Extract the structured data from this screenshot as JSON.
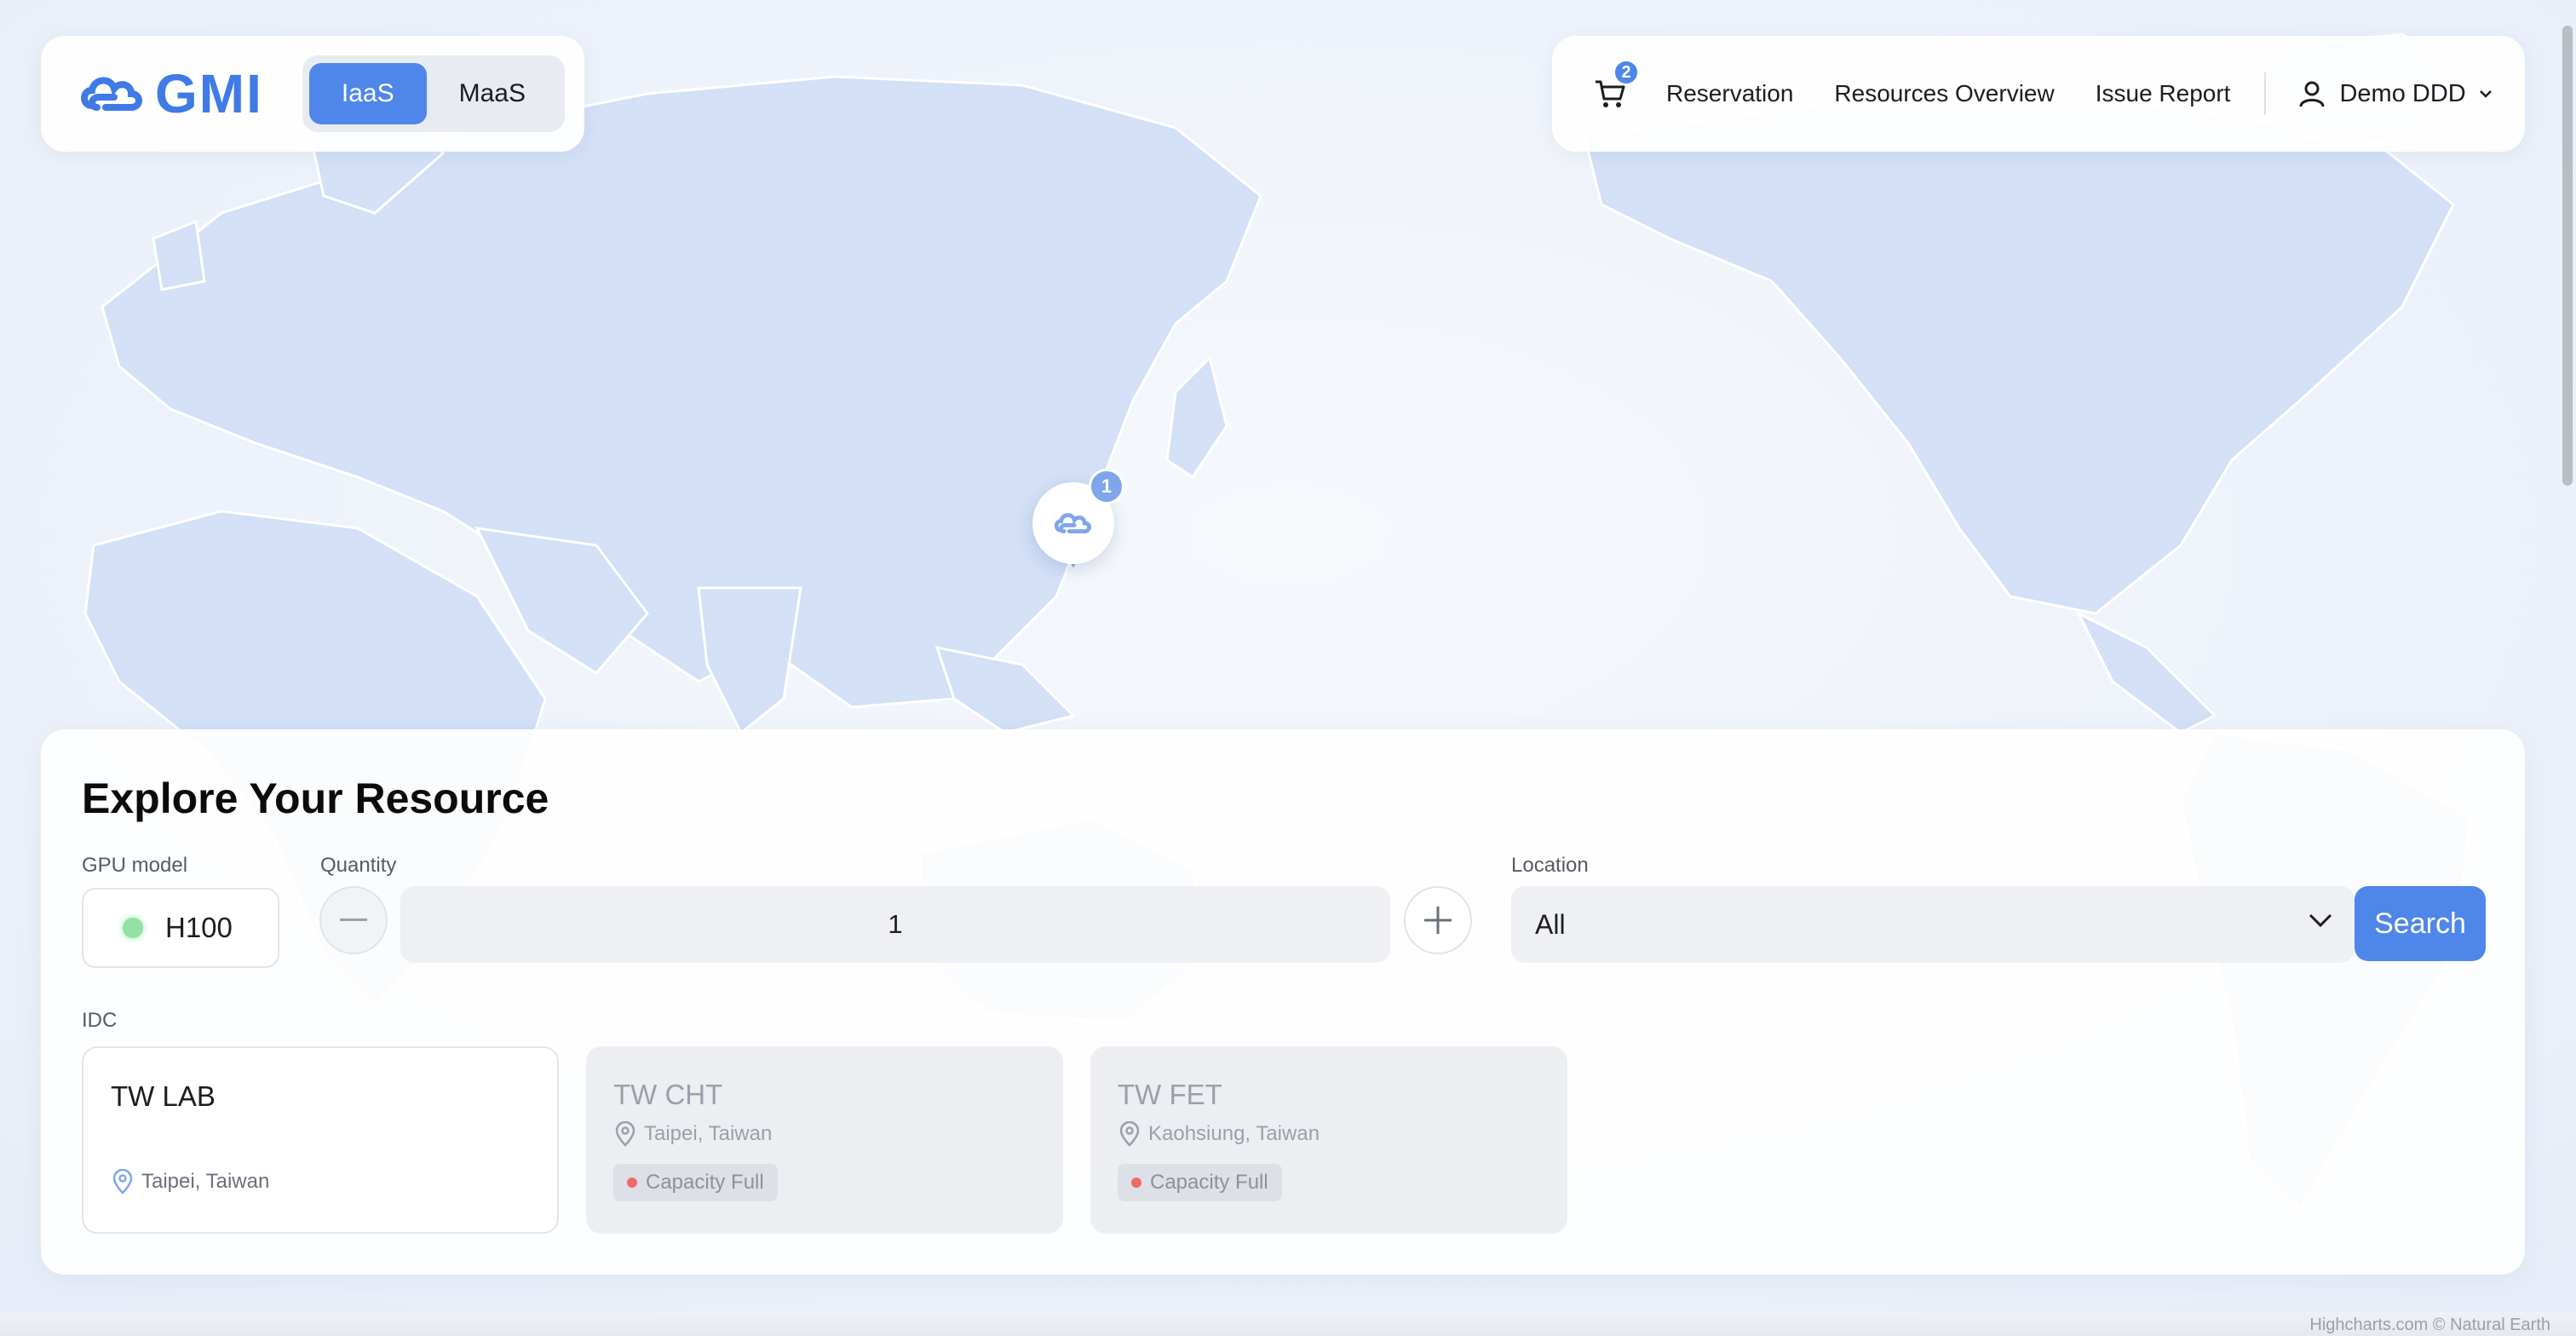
{
  "brand": {
    "logo_text": "GMI",
    "accent": "#4f86ea"
  },
  "product_switch": {
    "items": [
      "IaaS",
      "MaaS"
    ],
    "active": "IaaS"
  },
  "nav": {
    "cart_count": "2",
    "links": [
      "Reservation",
      "Resources Overview",
      "Issue Report"
    ],
    "user_name": "Demo DDD"
  },
  "map": {
    "marker_count": "1",
    "credits": "Highcharts.com © Natural Earth"
  },
  "explore": {
    "title": "Explore Your Resource",
    "gpu_label": "GPU model",
    "gpu_value": "H100",
    "quantity_label": "Quantity",
    "quantity_value": "1",
    "location_label": "Location",
    "location_value": "All",
    "search_label": "Search",
    "idc_label": "IDC",
    "idcs": [
      {
        "name": "TW LAB",
        "location": "Taipei, Taiwan",
        "status": ""
      },
      {
        "name": "TW CHT",
        "location": "Taipei, Taiwan",
        "status": "Capacity Full"
      },
      {
        "name": "TW FET",
        "location": "Kaohsiung, Taiwan",
        "status": "Capacity Full"
      }
    ]
  }
}
